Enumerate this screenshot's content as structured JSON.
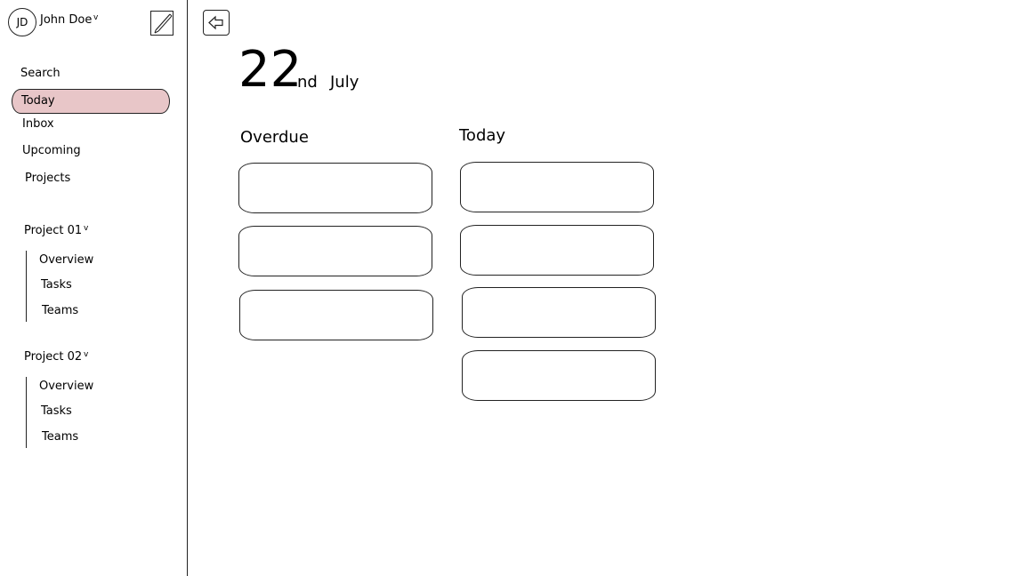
{
  "user": {
    "initials": "JD",
    "name": "John Doe",
    "chevron": "v"
  },
  "nav": {
    "search": "Search",
    "today": "Today",
    "inbox": "Inbox",
    "upcoming": "Upcoming",
    "projects": "Projects"
  },
  "projects": [
    {
      "name": "Project 01",
      "chevron": "v",
      "items": [
        "Overview",
        "Tasks",
        "Teams"
      ]
    },
    {
      "name": "Project 02",
      "chevron": "v",
      "items": [
        "Overview",
        "Tasks",
        "Teams"
      ]
    }
  ],
  "date": {
    "day": "22",
    "suffix": "nd",
    "month": "July"
  },
  "columns": {
    "overdue": {
      "title": "Overdue",
      "card_count": 3
    },
    "today": {
      "title": "Today",
      "card_count": 4
    }
  },
  "colors": {
    "selected_bg": "#e8c6c8",
    "outline": "#222222"
  },
  "icons": {
    "compose": "compose-pencil-icon",
    "back": "back-arrow-icon"
  }
}
